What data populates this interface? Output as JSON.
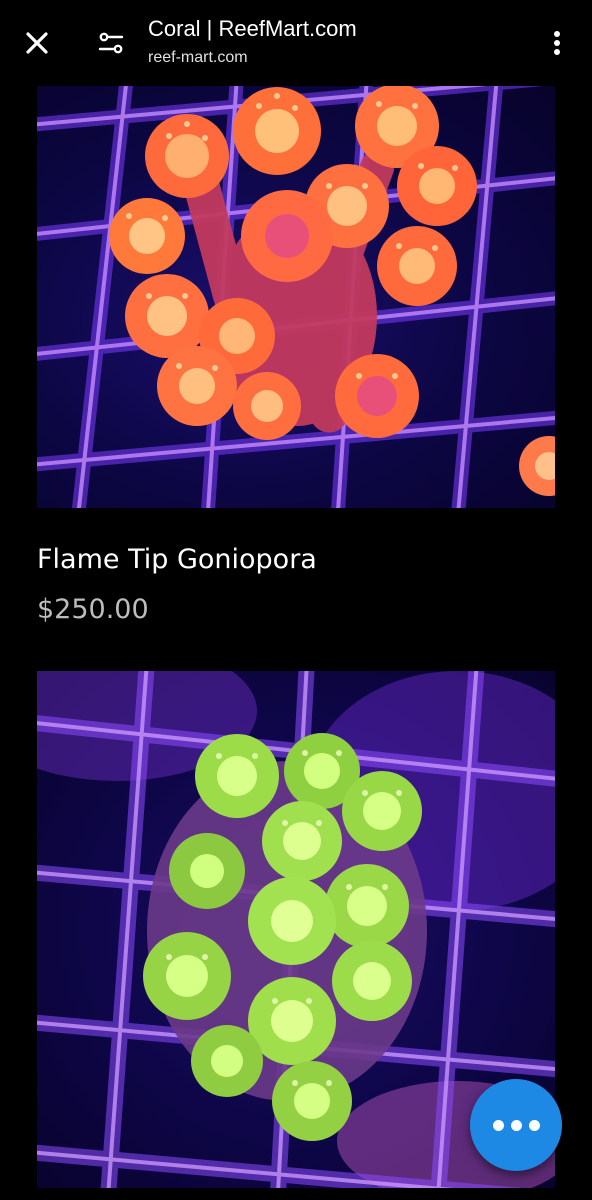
{
  "header": {
    "title": "Coral | ReefMart.com",
    "url": "reef-mart.com",
    "close_icon": "close-icon",
    "tune_icon": "tune-icon",
    "more_icon": "more-vertical-icon"
  },
  "products": [
    {
      "name": "Flame Tip Goniopora",
      "price": "$250.00",
      "image_subject": "orange goniopora coral on blue grid",
      "accent_color": "#ff6a3d"
    },
    {
      "image_subject": "green goniopora coral on purple grid",
      "accent_color": "#b6ff4a"
    }
  ],
  "fab": {
    "icon": "more-horizontal-icon",
    "color": "#1e88e5"
  }
}
